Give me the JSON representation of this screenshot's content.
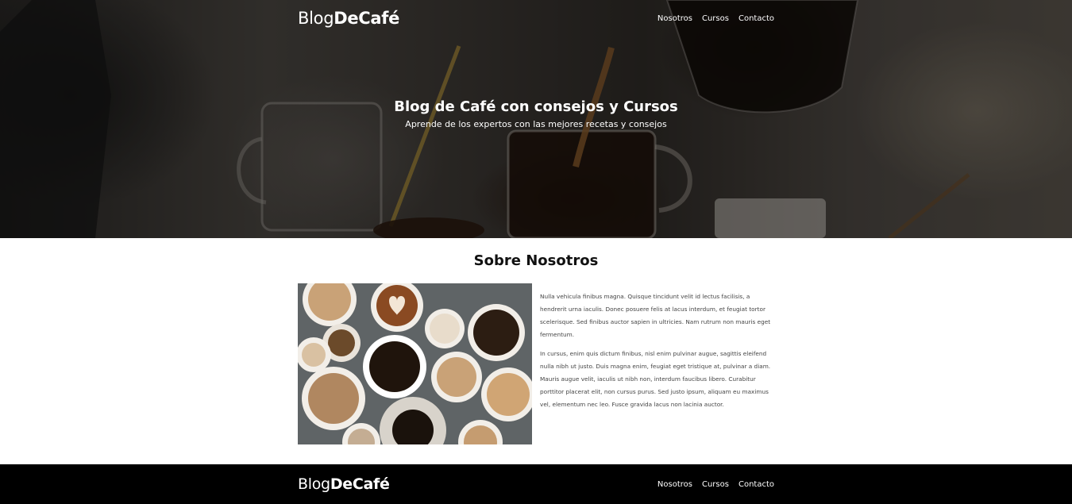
{
  "header": {
    "logo_light": "Blog",
    "logo_bold": "DeCafé",
    "nav": [
      "Nosotros",
      "Cursos",
      "Contacto"
    ]
  },
  "hero": {
    "title": "Blog de Café con consejos y Cursos",
    "subtitle": "Aprende de los expertos con las mejores recetas y consejos"
  },
  "about": {
    "title": "Sobre Nosotros",
    "paragraphs": [
      "Nulla vehicula finibus magna. Quisque tincidunt velit id lectus facilisis, a hendrerit urna iaculis. Donec posuere felis at lacus interdum, et feugiat tortor scelerisque. Sed finibus auctor sapien in ultricies. Nam rutrum non mauris eget fermentum.",
      "In cursus, enim quis dictum finibus, nisl enim pulvinar augue, sagittis eleifend nulla nibh ut justo. Duis magna enim, feugiat eget tristique at, pulvinar a diam. Mauris augue velit, iaculis ut nibh non, interdum faucibus libero. Curabitur porttitor placerat elit, non cursus purus. Sed justo ipsum, aliquam eu maximus vel, elementum nec leo. Fusce gravida lacus non lacinia auctor."
    ]
  },
  "footer": {
    "logo_light": "Blog",
    "logo_bold": "DeCafé",
    "nav": [
      "Nosotros",
      "Cursos",
      "Contacto"
    ]
  },
  "colors": {
    "footer_bg": "#000000",
    "text_white": "#ffffff",
    "body_text": "#444444"
  }
}
